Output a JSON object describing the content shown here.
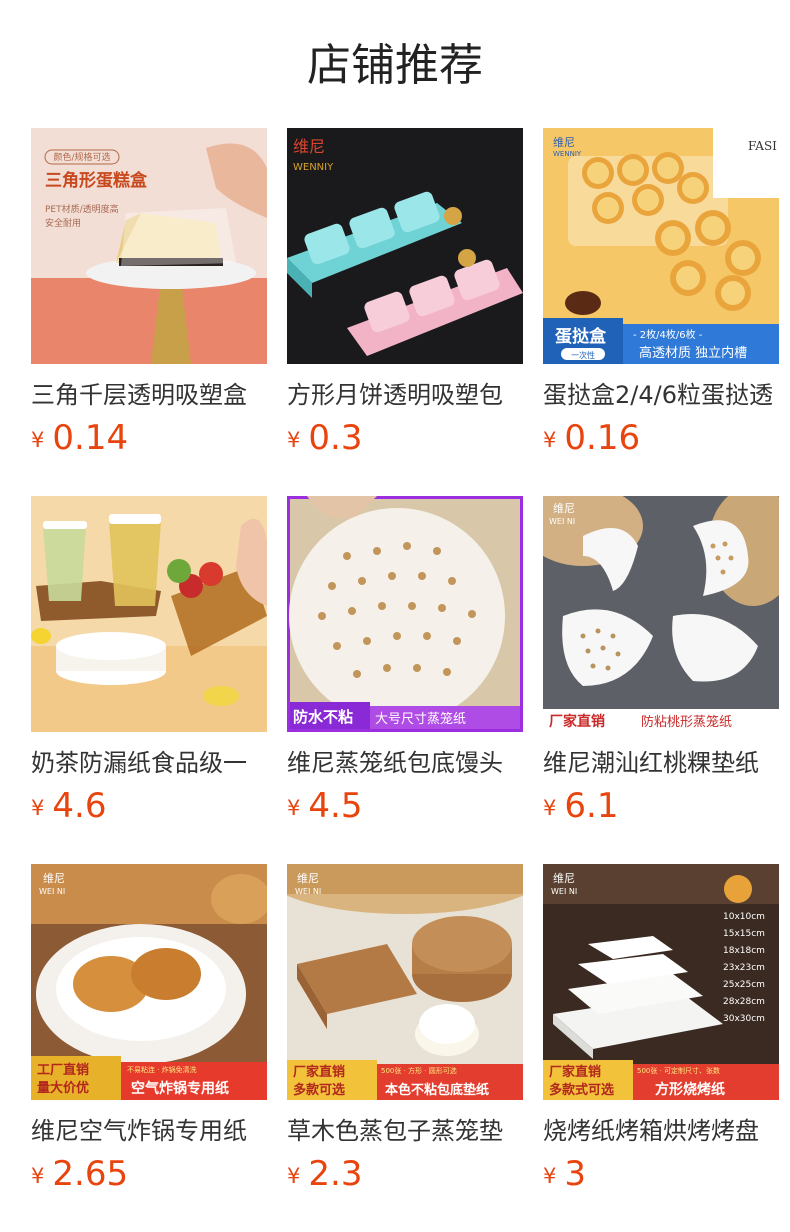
{
  "header": {
    "title": "店铺推荐"
  },
  "currency": "¥",
  "products": [
    {
      "name": "三角千层透明吸塑盒",
      "price": "0.14",
      "image_text": [
        "颜色/规格可选",
        "三角形蛋糕盒",
        "PET材质/透明度高",
        "安全耐用"
      ]
    },
    {
      "name": "方形月饼透明吸塑包",
      "price": "0.3",
      "image_text": [
        "维尼",
        "WENNIY"
      ]
    },
    {
      "name": "蛋挞盒2/4/6粒蛋挞透",
      "price": "0.16",
      "image_text": [
        "维尼",
        "WENNIY",
        "蛋挞盒",
        "一次性",
        "- 2枚/4枚/6枚 -",
        "高透材质 独立内槽",
        "FASI"
      ]
    },
    {
      "name": "奶茶防漏纸食品级一",
      "price": "4.6",
      "image_text": []
    },
    {
      "name": "维尼蒸笼纸包底馒头",
      "price": "4.5",
      "image_text": [
        "防水不粘",
        "大号尺寸蒸笼纸"
      ]
    },
    {
      "name": "维尼潮汕红桃粿垫纸",
      "price": "6.1",
      "image_text": [
        "维尼",
        "WEI NI",
        "厂家直销",
        "防粘桃形蒸笼纸"
      ]
    },
    {
      "name": "维尼空气炸锅专用纸",
      "price": "2.65",
      "image_text": [
        "维尼",
        "WEI NI",
        "工厂直销",
        "量大价优",
        "不易粘连 · 炸锅免清洗",
        "空气炸锅专用纸"
      ]
    },
    {
      "name": "草木色蒸包子蒸笼垫",
      "price": "2.3",
      "image_text": [
        "维尼",
        "WEI NI",
        "厂家直销",
        "多款可选",
        "500张 · 方形 · 圆形可选",
        "本色不粘包底垫纸"
      ]
    },
    {
      "name": "烧烤纸烤箱烘烤烤盘",
      "price": "3",
      "image_text": [
        "维尼",
        "WEI NI",
        "10x10cm",
        "15x15cm",
        "18x18cm",
        "23x23cm",
        "25x25cm",
        "28x28cm",
        "30x30cm",
        "厂家直销",
        "多款式可选",
        "500张 · 可定制尺寸、张数",
        "方形烧烤纸"
      ]
    }
  ]
}
